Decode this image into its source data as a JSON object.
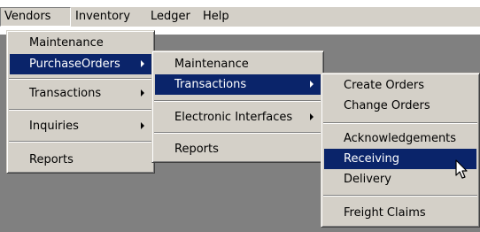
{
  "menubar": {
    "items": [
      {
        "label": "Vendors"
      },
      {
        "label": "Inventory"
      },
      {
        "label": "Ledger"
      },
      {
        "label": "Help"
      }
    ]
  },
  "vendors_menu": {
    "items": [
      {
        "label": "Maintenance"
      },
      {
        "label": "PurchaseOrders"
      },
      {
        "label": "Transactions"
      },
      {
        "label": "Inquiries"
      },
      {
        "label": "Reports"
      }
    ]
  },
  "purchaseorders_menu": {
    "items": [
      {
        "label": "Maintenance"
      },
      {
        "label": "Transactions"
      },
      {
        "label": "Electronic Interfaces"
      },
      {
        "label": "Reports"
      }
    ]
  },
  "transactions_menu": {
    "items": [
      {
        "label": "Create Orders"
      },
      {
        "label": "Change Orders"
      },
      {
        "label": "Acknowledgements"
      },
      {
        "label": "Receiving"
      },
      {
        "label": "Delivery"
      },
      {
        "label": "Freight Claims"
      }
    ]
  },
  "colors": {
    "highlight": "#0a246a",
    "menu_face": "#d4d0c8",
    "client_area": "#808080"
  },
  "icons": {
    "submenu_arrow": "chevron-right-icon",
    "cursor": "mouse-pointer-icon"
  }
}
